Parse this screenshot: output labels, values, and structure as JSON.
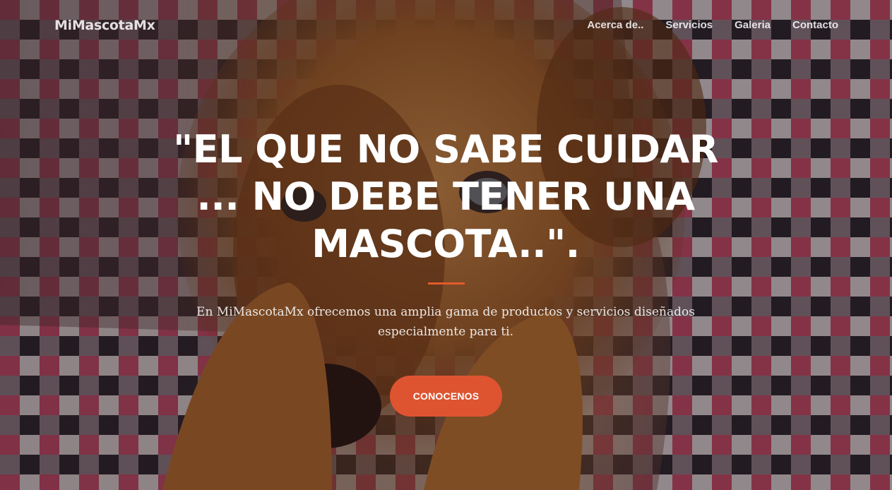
{
  "header": {
    "brand": "MiMascotaMx",
    "nav": [
      "Acerca de..",
      "Servicios",
      "Galeria",
      "Contacto"
    ]
  },
  "hero": {
    "headline": "\"EL QUE NO SABE CUIDAR ... NO DEBE TENER UNA MASCOTA..\".",
    "lead": "En MiMascotaMx ofrecemos una amplia gama de productos y servicios diseñados especialmente para ti.",
    "cta_label": "CONOCENOS",
    "background_image": "puppy resting on plaid blanket",
    "colors": {
      "accent": "#e35a2c",
      "button": "#de5430"
    }
  }
}
